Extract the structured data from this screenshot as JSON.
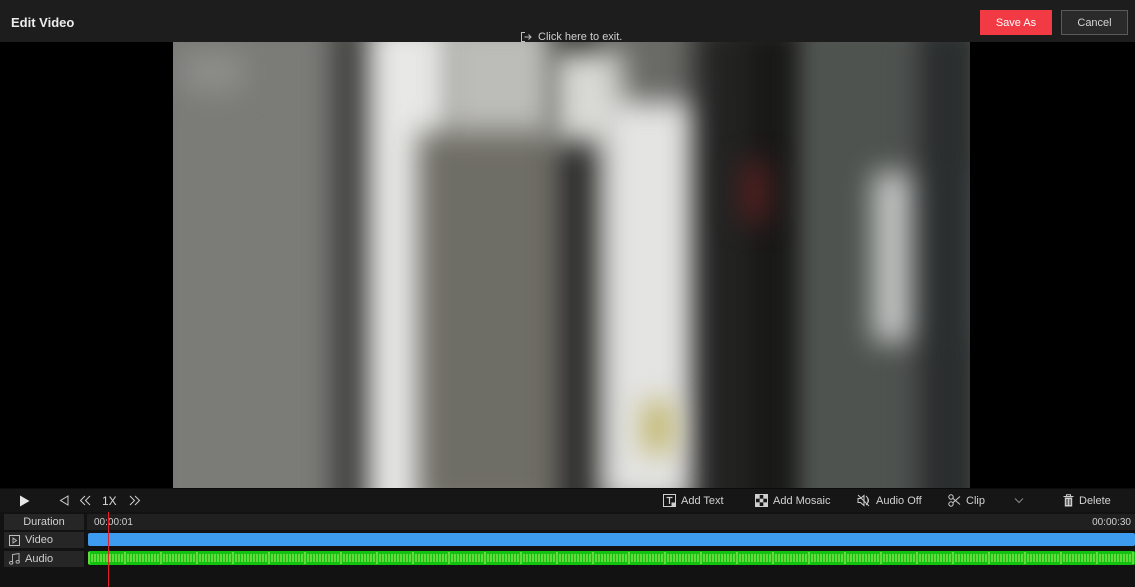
{
  "header": {
    "title": "Edit Video",
    "exit_hint": "Click here to exit.",
    "save_label": "Save As",
    "cancel_label": "Cancel"
  },
  "playback": {
    "speed": "1X"
  },
  "tools": {
    "add_text": "Add Text",
    "add_mosaic": "Add Mosaic",
    "audio_off": "Audio Off",
    "clip": "Clip",
    "delete": "Delete"
  },
  "timeline": {
    "duration_label": "Duration",
    "time_start": "00:00:01",
    "time_end": "00:00:30",
    "video_label": "Video",
    "audio_label": "Audio",
    "playhead_fraction": 0.019
  },
  "colors": {
    "accent": "#f23a44",
    "video_track": "#3e9cf0",
    "audio_track": "#11c211",
    "playhead": "#e2202a"
  },
  "icons": {
    "exit": "exit-icon",
    "play": "play-icon",
    "step_back": "step-back-icon",
    "rewind": "rewind-icon",
    "fast_forward": "fast-forward-icon",
    "add_text": "add-text-icon",
    "add_mosaic": "mosaic-icon",
    "audio_off": "speaker-off-icon",
    "clip": "scissors-icon",
    "clip_dropdown": "chevron-down-icon",
    "delete": "trash-icon",
    "video_track": "video-track-icon",
    "audio_track": "music-note-icon"
  }
}
